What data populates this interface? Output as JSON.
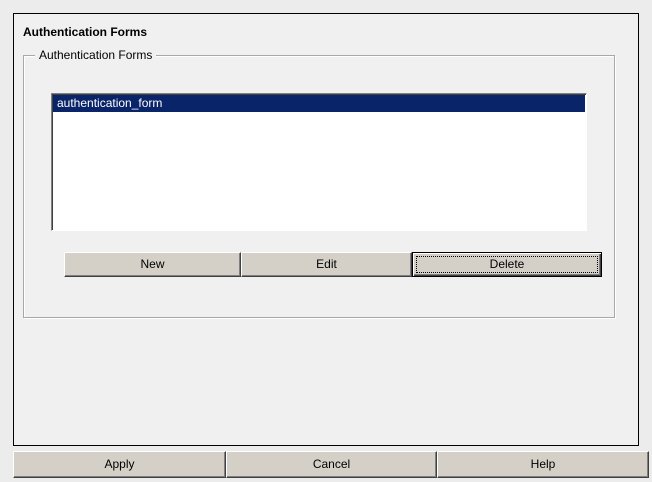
{
  "page": {
    "title": "Authentication Forms"
  },
  "group": {
    "legend": "Authentication Forms",
    "items": [
      {
        "label": "authentication_form",
        "selected": true
      }
    ],
    "buttons": {
      "new_label": "New",
      "edit_label": "Edit",
      "delete_label": "Delete"
    }
  },
  "footer": {
    "apply_label": "Apply",
    "cancel_label": "Cancel",
    "help_label": "Help"
  },
  "colors": {
    "selection": "#0a246a",
    "button_face": "#d4d0c8",
    "panel_bg": "#f0f0f0"
  }
}
